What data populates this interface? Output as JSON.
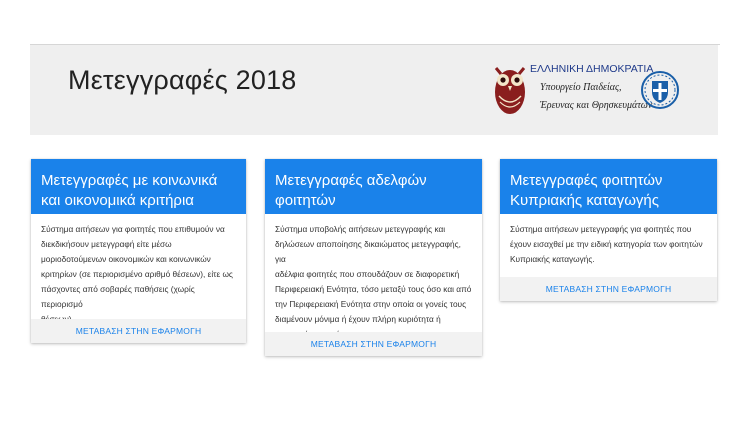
{
  "header": {
    "title": "Μετεγγραφές 2018",
    "logo": {
      "line1": "ΕΛΛΗΝΙΚΗ ΔΗΜΟΚΡΑΤΙΑ",
      "line2": "Υπουργείο Παιδείας,",
      "line3": "Έρευνας και Θρησκευμάτων",
      "icons": [
        "owl-icon",
        "greek-emblem-icon"
      ]
    }
  },
  "colors": {
    "accent": "#1a82ea",
    "header_bg": "#efefef",
    "footer_bg": "#f2f2f2"
  },
  "cards": [
    {
      "title_line1": "Μετεγγραφές με κοινωνικά",
      "title_line2": "και οικονομικά κριτήρια",
      "body": [
        "Σύστημα αιτήσεων για φοιτητές που επιθυμούν να",
        "διεκδικήσουν μετεγγραφή είτε μέσω",
        "μοριοδοτούμενων οικονομικών και κοινωνικών",
        "κριτηρίων (σε περιορισμένο αριθμό θέσεων), είτε ως",
        "πάσχοντες από σοβαρές παθήσεις (χωρίς περιορισμό",
        "θέσεων)."
      ],
      "link": "ΜΕΤΑΒΑΣΗ ΣΤΗΝ ΕΦΑΡΜΟΓΗ"
    },
    {
      "title_line1": "Μετεγγραφές αδελφών",
      "title_line2": "φοιτητών",
      "body": [
        "Σύστημα υποβολής αιτήσεων μετεγγραφής και",
        "δηλώσεων αποποίησης δικαιώματος μετεγγραφής, για",
        "αδέλφια φοιτητές που σπουδάζουν σε διαφορετική",
        "Περιφερειακή Ενότητα, τόσο μεταξύ τους όσο και από",
        "την Περιφερειακή Ενότητα στην οποία οι γονείς τους",
        "διαμένουν μόνιμα ή έχουν πλήρη κυριότητα ή",
        "επικαρπία κατοικίας."
      ],
      "link": "ΜΕΤΑΒΑΣΗ ΣΤΗΝ ΕΦΑΡΜΟΓΗ"
    },
    {
      "title_line1": "Μετεγγραφές φοιτητών",
      "title_line2": "Κυπριακής καταγωγής",
      "body": [
        "Σύστημα αιτήσεων μετεγγραφής για φοιτητές που",
        "έχουν εισαχθεί με την ειδική κατηγορία των φοιτητών",
        "Κυπριακής καταγωγής."
      ],
      "link": "ΜΕΤΑΒΑΣΗ ΣΤΗΝ ΕΦΑΡΜΟΓΗ"
    }
  ]
}
